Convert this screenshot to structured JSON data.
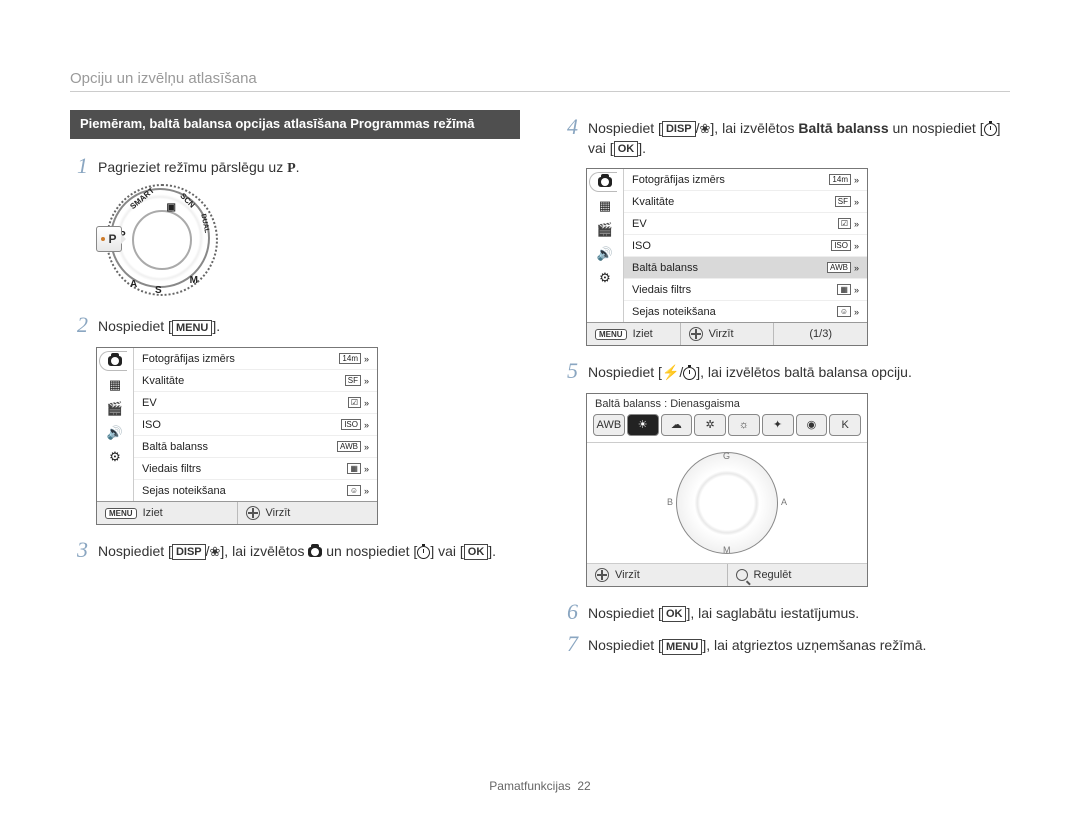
{
  "header": {
    "title": "Opciju un izvēlņu atlasīšana"
  },
  "banner": "Piemēram, baltā balansa opcijas atlasīšana Programmas režīmā",
  "glyphs": {
    "menu": "MENU",
    "ok": "OK",
    "disp": "DISP",
    "P": "P",
    "flash": "⚡",
    "flower": "❀"
  },
  "steps": {
    "s1": {
      "n": "1",
      "a": "Pagrieziet režīmu pārslēgu uz ",
      "b": "."
    },
    "s2": {
      "n": "2",
      "a": "Nospiediet [",
      "b": "]."
    },
    "s3": {
      "n": "3",
      "a": "Nospiediet [",
      "mid1": "/",
      "b": "], lai izvēlētos ",
      "c": " un nospiediet [",
      "d": "] vai [",
      "e": "]."
    },
    "s4": {
      "n": "4",
      "a": "Nospiediet [",
      "mid1": "/",
      "b": "], lai izvēlētos ",
      "bold": "Baltā balanss",
      "c": " un nospiediet [",
      "d": "] vai [",
      "e": "]."
    },
    "s5": {
      "n": "5",
      "a": "Nospiediet [",
      "mid1": "/",
      "b": "], lai izvēlētos baltā balansa opciju."
    },
    "s6": {
      "n": "6",
      "a": "Nospiediet [",
      "b": "], lai saglabātu iestatījumus."
    },
    "s7": {
      "n": "7",
      "a": "Nospiediet [",
      "b": "], lai atgrieztos uzņemšanas režīmā."
    }
  },
  "dial": {
    "P": "P",
    "A": "A",
    "S": "S",
    "M": "M",
    "smart": "SMART",
    "scn": "SCN",
    "dual": "DUAL",
    "cam": "▣",
    "pointer": "P"
  },
  "menuRows": [
    {
      "name": "Fotogrāfijas izmērs",
      "val": "14m",
      "chev": true
    },
    {
      "name": "Kvalitāte",
      "val": "SF",
      "chev": true
    },
    {
      "name": "EV",
      "val": "☑",
      "chev": true
    },
    {
      "name": "ISO",
      "val": "ISO",
      "chev": true
    },
    {
      "name": "Baltā balanss",
      "val": "AWB",
      "chev": true
    },
    {
      "name": "Viedais filtrs",
      "val": "▦",
      "chev": true
    },
    {
      "name": "Sejas noteikšana",
      "val": "☺",
      "chev": true
    }
  ],
  "menu2_selected_index": 4,
  "lcdFoot": {
    "exit": "Iziet",
    "move": "Virzīt",
    "page": "(1/3)"
  },
  "wb": {
    "title": "Baltā balanss : Dienasgaisma",
    "chips": [
      "AWB",
      "☀",
      "☁",
      "✲",
      "☼",
      "✦",
      "◉",
      "K"
    ],
    "selectedIndex": 1,
    "axisG": "G",
    "axisM": "M",
    "axisB": "B",
    "axisA": "A",
    "foot": {
      "move": "Virzīt",
      "adjust": "Regulēt"
    }
  },
  "footer": {
    "section": "Pamatfunkcijas",
    "page": "22"
  }
}
